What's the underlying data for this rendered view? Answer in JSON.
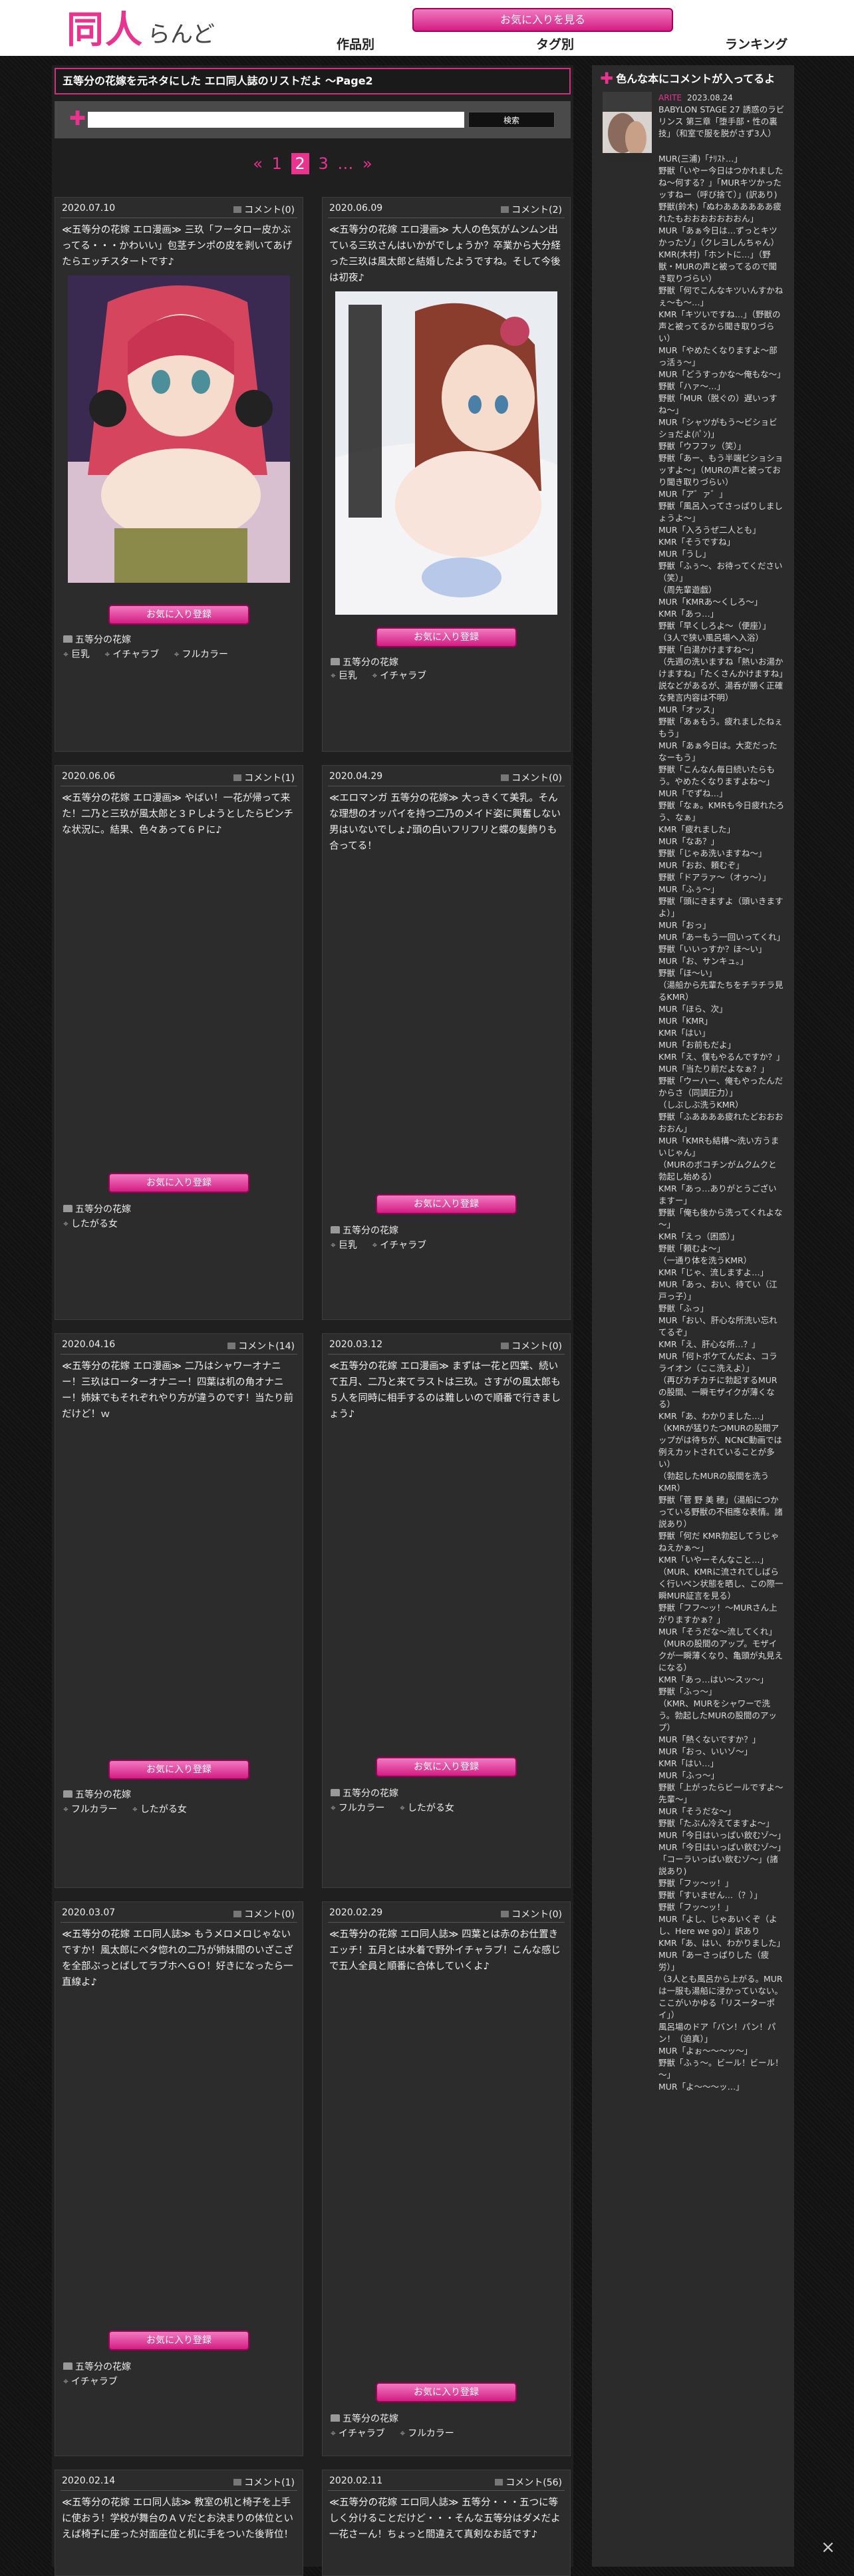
{
  "header": {
    "logo_main": "同人",
    "logo_sub": "らんど",
    "favorite_button": "お気に入りを見る",
    "nav": [
      "作品別",
      "タグ別",
      "ランキング"
    ]
  },
  "page_title": "五等分の花嫁を元ネタにした エロ同人誌のリストだよ ～Page2",
  "search": {
    "placeholder": "",
    "button": "検索"
  },
  "pagination": [
    "«",
    "1",
    "2",
    "3",
    "…",
    "»"
  ],
  "fav_label": "お気に入り登録",
  "posts": [
    {
      "date": "2020.07.10",
      "comments": "コメント(0)",
      "desc": "≪五等分の花嫁 エロ漫画≫ 三玖「フータロー皮かぶってる・・・かわいい」包茎チンポの皮を剥いてあげたらエッチスタートです♪",
      "category": "五等分の花嫁",
      "tags": [
        "巨乳",
        "イチャラブ",
        "フルカラー"
      ]
    },
    {
      "date": "2020.06.09",
      "comments": "コメント(2)",
      "desc": "≪五等分の花嫁 エロ漫画≫ 大人の色気がムンムン出ている三玖さんはいかがでしょうか？卒業から大分経った三玖は風太郎と結婚したようですね。そして今後は初夜♪",
      "category": "五等分の花嫁",
      "tags": [
        "巨乳",
        "イチャラブ"
      ]
    },
    {
      "date": "2020.06.06",
      "comments": "コメント(1)",
      "desc": "≪五等分の花嫁 エロ漫画≫ やばい！一花が帰って来た！二乃と三玖が風太郎と３Ｐしようとしたらピンチな状況に。結果、色々あって６Ｐに♪",
      "category": "五等分の花嫁",
      "tags": [
        "したがる女"
      ]
    },
    {
      "date": "2020.04.29",
      "comments": "コメント(0)",
      "desc": "≪エロマンガ 五等分の花嫁≫ 大っきくて美乳。そんな理想のオッパイを持つ二乃のメイド姿に興奮しない男はいないでしょ♪頭の白いフリフリと蝶の髪飾りも合ってる！",
      "category": "五等分の花嫁",
      "tags": [
        "巨乳",
        "イチャラブ"
      ]
    },
    {
      "date": "2020.04.16",
      "comments": "コメント(14)",
      "desc": "≪五等分の花嫁 エロ漫画≫ 二乃はシャワーオナニー！三玖はローターオナニー！四葉は机の角オナニー！姉妹でもそれぞれやり方が違うのです！当たり前だけど！ｗ",
      "category": "五等分の花嫁",
      "tags": [
        "フルカラー",
        "したがる女"
      ]
    },
    {
      "date": "2020.03.12",
      "comments": "コメント(0)",
      "desc": "≪五等分の花嫁 エロ漫画≫ まずは一花と四葉、続いて五月、二乃と来てラストは三玖。さすがの風太郎も５人を同時に相手するのは難しいので順番で行きましょう♪",
      "category": "五等分の花嫁",
      "tags": [
        "フルカラー",
        "したがる女"
      ]
    },
    {
      "date": "2020.03.07",
      "comments": "コメント(0)",
      "desc": "≪五等分の花嫁 エロ同人誌≫ もうメロメロじゃないですか！風太郎にベタ惚れの二乃が姉妹間のいざこざを全部ぶっとばしてラブホへＧＯ！好きになったら一直線よ♪",
      "category": "五等分の花嫁",
      "tags": [
        "イチャラブ"
      ]
    },
    {
      "date": "2020.02.29",
      "comments": "コメント(0)",
      "desc": "≪五等分の花嫁 エロ同人誌≫ 四葉とは赤のお仕置きエッチ！五月とは水着で野外イチャラブ！こんな感じで五人全員と順番に合体していくよ♪",
      "category": "五等分の花嫁",
      "tags": [
        "イチャラブ",
        "フルカラー"
      ]
    },
    {
      "date": "2020.02.14",
      "comments": "コメント(1)",
      "desc": "≪五等分の花嫁 エロ同人誌≫ 教室の机と椅子を上手に使おう！学校が舞台のＡＶだとお決まりの体位といえば椅子に座った対面座位と机に手をついた後背位！",
      "category": "",
      "tags": []
    },
    {
      "date": "2020.02.11",
      "comments": "コメント(56)",
      "desc": "≪五等分の花嫁 エロ同人誌≫ 五等分・・・五つに等しく分けることだけど・・・そんな五等分はダメだよ一花さーん！ちょっと間違えて真剣なお話です♪",
      "category": "",
      "tags": []
    }
  ],
  "sidebar": {
    "title": "色んな本にコメントが入ってるよ",
    "user": "ARITE",
    "date": "2023.08.24",
    "book": "BABYLON STAGE 27 誘惑のラビリンス 第三章「堕手部・性の裏技」（和室で服を脱がさず3人）",
    "lines": [
      "MUR(三浦)「ﾅﾘｽﾄ…」",
      "野獣「いやー今日はつかれましたね～何する？」「MURキツかったッすねー（呼び捨て）」(訳あり)",
      "野獣(鈴木)「ぬわああああああ疲れたもおおおおおおおん」",
      "MUR「あぁ今日は…ずっとキツかったゾ」（クレヨしんちゃん）",
      "KMR(木村)「ホントに…」（野獣・MURの声と被ってるので聞き取りづらい）",
      "野獣「何でこんなキツいんすかねぇ～も～…」",
      "KMR「キツいですね…」（野獣の声と被ってるから聞き取りづらい）",
      "MUR「やめたくなりますよ～部っ活ぅ～」",
      "MUR「どうすっかな～俺もな～」",
      "野獣「ハァ～…」",
      "野獣「MUR（脱ぐの）遅いっすね～」",
      "MUR「シャツがもう～ビショビショだよ(ﾊﾟﾝ)」",
      "野獣「ウフフッ（笑）」",
      "野獣「あー、もう半端ビショショッすよ～」（MURの声と被っており聞き取りづらい）",
      "MUR「ア゛ァ゛」",
      "野獣「風呂入ってさっぱりしましょうよ～」",
      "MUR「入ろうぜ二人とも」",
      "KMR「そうですね」",
      "MUR「うし」",
      "野獣「ふぅ～、お待ってください（笑）」",
      "（周先輩遊戯）",
      "MUR「KMRあ～くしろ～」",
      "KMR「あっ…」",
      "野獣「早くしろよ～（便座）」",
      "（3人で狭い風呂場へ入浴）",
      "野獣「白湯かけますね～」",
      "（先週の洗いますね「熱いお湯かけますね」「たくさんかけますね」説などがあるが、湯呑が勝く正確な発言内容は不明）",
      "MUR「オッス」",
      "野獣「あぁもう。疲れましたねぇもう」",
      "MUR「あぁ今日は。大変だったなーもう」",
      "野獣「こんなん毎日続いたらもう。やめたくなりますよね～」",
      "MUR「でずね…」",
      "野獣「なぁ。KMRも今日疲れたろう、なぁ」",
      "KMR「疲れました」",
      "MUR「なあ？」",
      "野獣「じゃあ洗いますね～」",
      "MUR「おお、頼むぞ」",
      "野獣「ドアラァ～（オゥ～）」",
      "MUR「ふぅ～」",
      "野獣「頭にきますよ（頭いきますよ）」",
      "MUR「おっ」",
      "MUR「あーもう一回いってくれ」",
      "野獣「いいっすか？ほ～い」",
      "MUR「お、サンキュ。」",
      "野獣「ほ～い」",
      "（湯船から先輩たちをチラチラ見るKMR）",
      "MUR「ほら、次」",
      "MUR「KMR」",
      "KMR「はい」",
      "MUR「お前もだよ」",
      "KMR「え、僕もやるんですか？」",
      "MUR「当たり前だよなぁ？」",
      "野獣「ウーハー、俺もやったんだからさ（同調圧力）」",
      "（しぶしぶ洗うKMR）",
      "野獣「ふああああ疲れたどおおおおおん」",
      "MUR「KMRも結構～洗い方うまいじゃん」",
      "（MURのボコチンがムクムクと勃起し始める）",
      "KMR「あっ…ありがとうございますー」",
      "野獣「俺も後から洗ってくれよな～」",
      "KMR「えっ（困惑）」",
      "野獣「頼むよ～」",
      "（一通り体を洗うKMR）",
      "KMR「じゃ、流しますよ…」",
      "MUR「あっ、おい、待てい（江戸っ子）」",
      "野獣「ふっ」",
      "MUR「おい、肝心な所洗い忘れてるぞ」",
      "KMR「え、肝心な所…？」",
      "MUR「何トボケてんだよ、コラライオン（ここ洗えよ）」",
      "（再びカチカチに勃起するMURの股間、一瞬モザイクが薄くなる）",
      "KMR「あ、わかりました…」",
      "（KMRが猛りたつMURの股間アップがは待ちが、NCNC動画では例えカットされていることが多い）",
      "（勃起したMURの股間を洗うKMR）",
      "野獣「菅 野 美 穂」（湯船につかっている野獣の不相應な表情。諸説あり）",
      "野獣「何だ KMR勃起してうじゃねえかぁ～」",
      "KMR「いやーそんなこと…」",
      "（MUR、KMRに流されてしばらく行いペン状態を晒し、この際一瞬MUR証言を見る）",
      "野獣「フフ～ッ！～MURさん上がりますかぁ？」",
      "MUR「そうだな～流してくれ」",
      "（MURの股間のアップ。モザイクが一瞬薄くなり、亀頭が丸見えになる）",
      "KMR「あっ…はい～スッ～」",
      "野獣「ふっ～」",
      "（KMR、MURをシャワーで洗う。勃起したMURの股間のアップ）",
      "MUR「熱くないですか？」",
      "MUR「おっ、いいゾ～」",
      "KMR「はい…」",
      "MUR「ふっ～」",
      "野獣「上がったらビールですよ～先輩～」",
      "MUR「そうだな～」",
      "野獣「たぶん冷えてますよ～」",
      "MUR「今日はいっぱい飲むゾ～」",
      "MUR「今日はいっぱい飲むゾ～」「コーラいっぱい飲むゾ～」(諸説あり)",
      "野獣「フッ～ッ！」",
      "野獣「すいません…（？）」",
      "野獣「フッ～ッ！」",
      "MUR「よし、じゃあいくぞ（よし、Here we go）」訳あり",
      "KMR「あ、はい、わかりました」",
      "MUR「あーさっぱりした（疲労）」",
      "（3人とも風呂から上がる。MURは一服も湯船に浸かっていない。ここがいかゆる「リスーターポイ」）",
      "風呂場のドア「バン！パン！パン！（迫真）」",
      "MUR「よぉ～～～ッ～」",
      "野獣「ふぅ～。ビール！ビール！～」",
      "MUR「よ～～～ッ…」"
    ]
  },
  "close_icon": "×"
}
